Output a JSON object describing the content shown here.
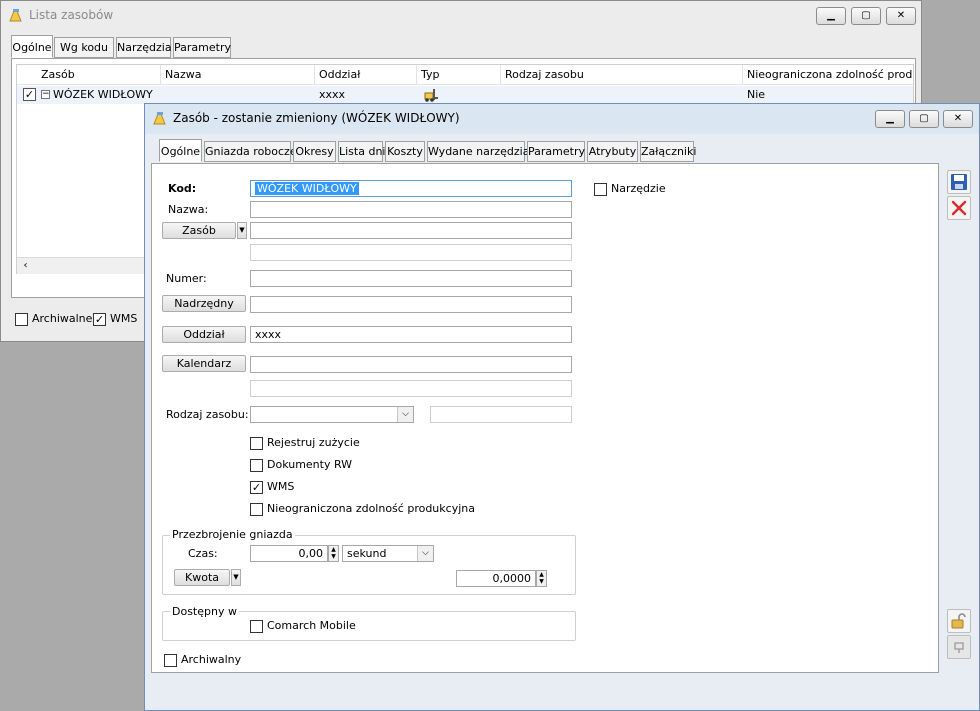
{
  "back_window": {
    "title": "Lista zasobów",
    "tabs": [
      "Ogólne",
      "Wg kodu",
      "Narzędzia",
      "Parametry"
    ],
    "columns": [
      "Zasób",
      "Nazwa",
      "Oddział",
      "Typ",
      "Rodzaj zasobu",
      "Nieograniczona zdolność produkcyj"
    ],
    "rows": [
      {
        "zasob": "WÓZEK WIDŁOWY",
        "nazwa": "",
        "oddzial": "xxxx",
        "typ_icon": "forklift-icon",
        "rodzaj": "",
        "nieograniczona": "Nie",
        "checked": true
      }
    ],
    "archiwalne_label": "Archiwalne",
    "wms_label": "WMS",
    "archiwalne_checked": false,
    "wms_checked": true
  },
  "front_window": {
    "title": "Zasób - zostanie zmieniony  (WÓZEK WIDŁOWY)",
    "tabs": [
      "Ogólne",
      "Gniazda robocze",
      "Okresy",
      "Lista dni",
      "Koszty",
      "Wydane narzędzia",
      "Parametry",
      "Atrybuty",
      "Załączniki"
    ],
    "form": {
      "kod_label": "Kod:",
      "kod_value": "WÓZEK WIDŁOWY",
      "nazwa_label": "Nazwa:",
      "nazwa_value": "",
      "zasob_button": "Zasób",
      "zasob_value": "",
      "zasob_value2": "",
      "numer_label": "Numer:",
      "numer_value": "",
      "nadrzedny_button": "Nadrzędny",
      "nadrzedny_value": "",
      "oddzial_button": "Oddział",
      "oddzial_value": "xxxx",
      "kalendarz_button": "Kalendarz",
      "kalendarz_value": "",
      "kalendarz_value2": "",
      "rodzaj_label": "Rodzaj zasobu:",
      "rodzaj_value": "",
      "rodzaj_value2": "",
      "narzedzie_label": "Narzędzie",
      "narzedzie_checked": false,
      "checkboxes": [
        {
          "label": "Rejestruj zużycie",
          "checked": false
        },
        {
          "label": "Dokumenty RW",
          "checked": false
        },
        {
          "label": "WMS",
          "checked": true
        },
        {
          "label": "Nieograniczona zdolność produkcyjna",
          "checked": false
        }
      ],
      "przezbrojenie": {
        "group_label": "Przezbrojenie gniazda",
        "czas_label": "Czas:",
        "czas_value": "0,00",
        "czas_unit": "sekund",
        "kwota_button": "Kwota",
        "kwota_value": "0,0000"
      },
      "dostepny": {
        "group_label": "Dostępny w",
        "comarch_label": "Comarch Mobile",
        "comarch_checked": false
      },
      "archiwalny_label": "Archiwalny",
      "archiwalny_checked": false
    },
    "side_icons": [
      "save-icon",
      "delete-icon",
      "lock-icon",
      "pin-icon"
    ]
  },
  "colors": {
    "selection_blue": "#3399ff",
    "delete_red": "#d92b2b",
    "save_blue": "#2f5fb3",
    "desktop_gray": "#aaaaaa"
  }
}
